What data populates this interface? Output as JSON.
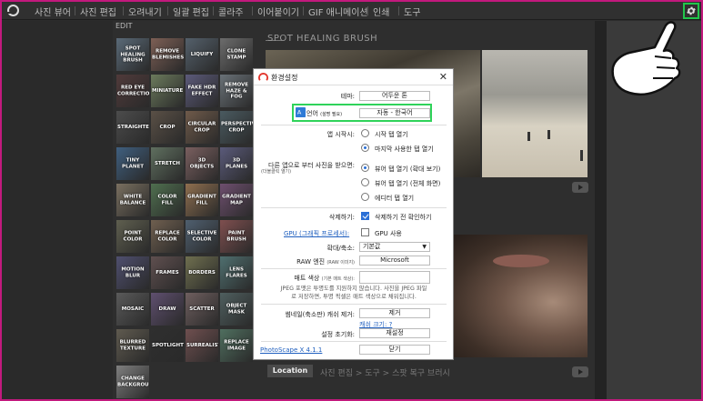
{
  "menu": [
    "사진 뷰어",
    "사진 편집",
    "오려내기",
    "일괄 편집",
    "콜라주",
    "이어붙이기",
    "GIF 애니메이션",
    "인쇄",
    "도구"
  ],
  "left": {
    "edit_label": "EDIT",
    "tools": [
      "SPOT HEALING BRUSH",
      "REMOVE BLEMISHES",
      "LIQUIFY",
      "CLONE STAMP",
      "RED EYE CORRECTION",
      "MINIATURE",
      "FAKE HDR EFFECT",
      "REMOVE HAZE & FOG",
      "STRAIGHTEN",
      "CROP",
      "CIRCULAR CROP",
      "PERSPECTIVE CROP",
      "TINY PLANET",
      "STRETCH",
      "3D OBJECTS",
      "3D PLANES",
      "WHITE BALANCE",
      "COLOR FILL",
      "GRADIENT FILL",
      "GRADIENT MAP",
      "POINT COLOR",
      "REPLACE COLOR",
      "SELECTIVE COLOR",
      "PAINT BRUSH",
      "MOTION BLUR",
      "FRAMES",
      "BORDERS",
      "LENS FLARES",
      "MOSAIC",
      "DRAW",
      "SCATTER",
      "OBJECT MASK",
      "BLURRED TEXTURE",
      "SPOTLIGHT",
      "SURREALISTIC",
      "REPLACE IMAGE",
      "CHANGE BACKGROUND"
    ]
  },
  "center": {
    "heading": "SPOT HEALING BRUSH",
    "location_button": "Location",
    "breadcrumb": "사진 편집 > 도구 > 스팟 복구 브러시"
  },
  "dialog": {
    "title": "환경설정",
    "close": "✕",
    "theme_label": "테마:",
    "theme_value": "어두운 톤",
    "language_label": "언어",
    "language_note": "(설명 필요)",
    "language_value": "자동 - 한국어",
    "startup_label": "앱 시작시:",
    "startup_opt1": "시작 탭 열기",
    "startup_opt2": "마지막 사용한 탭 열기",
    "receive_label": "다른 앱으로 부터 사진을 받으면:",
    "receive_sub": "(더블클릭 열기)",
    "receive_opt1": "뷰어 탭 열기 (확대 보기)",
    "receive_opt2": "뷰어 탭 열기 (전체 화면)",
    "receive_opt3": "에디터 탭 열기",
    "delete_label": "삭제하기:",
    "delete_check": "삭제하기 전 확인하기",
    "gpu_link": "GPU (그래픽 프로세서):",
    "gpu_check": "GPU 사용",
    "zoom_label": "확대/축소:",
    "zoom_value": "기본값",
    "raw_label": "RAW 엔진",
    "raw_sub": "(RAW 이미지)",
    "raw_value": "Microsoft",
    "matte_label": "매트 색상",
    "matte_sub": "(기본 매트 색상):",
    "matte_desc1": "JPEG 포맷은 투명도를 지원하지 않습니다. 사진을 JPEG 파일",
    "matte_desc2": "로 저장하면, 투명 픽셀은 매트 색상으로 채워집니다.",
    "thumb_label": "썸네일(축소판) 캐쉬 제거:",
    "thumb_button": "제거",
    "cache_link": "캐쉬 크기: ?",
    "reset_label": "설정 초기화:",
    "reset_button": "재설정",
    "version_link": "PhotoScape X 4.1.1",
    "close_button": "닫기"
  },
  "colors": {
    "frame_border": "#c2197d",
    "highlight": "#2fd35a",
    "link": "#1f5fbf"
  }
}
